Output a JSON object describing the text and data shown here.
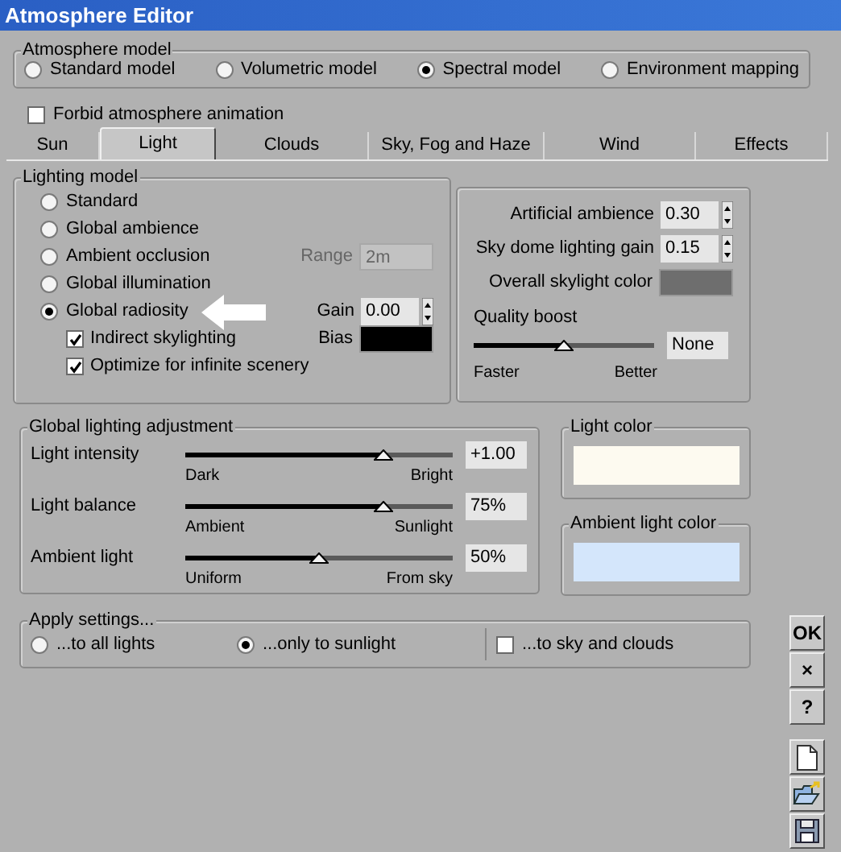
{
  "window": {
    "title": "Atmosphere Editor"
  },
  "atmosphere_model": {
    "label": "Atmosphere model",
    "options": [
      {
        "label": "Standard model",
        "selected": false
      },
      {
        "label": "Volumetric model",
        "selected": false
      },
      {
        "label": "Spectral model",
        "selected": true
      },
      {
        "label": "Environment mapping",
        "selected": false
      }
    ]
  },
  "forbid_animation": {
    "label": "Forbid atmosphere animation",
    "checked": false
  },
  "tabs": [
    {
      "label": "Sun",
      "selected": false
    },
    {
      "label": "Light",
      "selected": true
    },
    {
      "label": "Clouds",
      "selected": false
    },
    {
      "label": "Sky, Fog and Haze",
      "selected": false
    },
    {
      "label": "Wind",
      "selected": false
    },
    {
      "label": "Effects",
      "selected": false
    }
  ],
  "lighting_model": {
    "label": "Lighting model",
    "options": [
      {
        "label": "Standard",
        "selected": false
      },
      {
        "label": "Global ambience",
        "selected": false
      },
      {
        "label": "Ambient occlusion",
        "selected": false,
        "field": {
          "kind": "text",
          "label": "Range",
          "value": "2m",
          "disabled": true
        }
      },
      {
        "label": "Global illumination",
        "selected": false
      },
      {
        "label": "Global radiosity",
        "selected": true,
        "pointer": true,
        "field": {
          "kind": "spinner",
          "label": "Gain",
          "value": "0.00"
        }
      }
    ],
    "sub_options": [
      {
        "label": "Indirect skylighting",
        "checked": true,
        "field": {
          "kind": "swatch",
          "label": "Bias",
          "color": "#000000"
        }
      },
      {
        "label": "Optimize for infinite scenery",
        "checked": true
      }
    ]
  },
  "sky_settings": {
    "fields": [
      {
        "kind": "spinner",
        "label": "Artificial ambience",
        "value": "0.30"
      },
      {
        "kind": "spinner",
        "label": "Sky dome lighting gain",
        "value": "0.15"
      },
      {
        "kind": "swatch",
        "label": "Overall skylight color",
        "color": "#6e6e6e"
      }
    ],
    "quality_boost": {
      "label": "Quality boost",
      "level": 0.5,
      "value": "None",
      "min_label": "Faster",
      "max_label": "Better"
    }
  },
  "global_adjustment": {
    "label": "Global lighting adjustment",
    "sliders": [
      {
        "label": "Light intensity",
        "level": 0.74,
        "value": "+1.00",
        "min_label": "Dark",
        "max_label": "Bright"
      },
      {
        "label": "Light balance",
        "level": 0.74,
        "value": "75%",
        "min_label": "Ambient",
        "max_label": "Sunlight"
      },
      {
        "label": "Ambient light",
        "level": 0.5,
        "value": "50%",
        "min_label": "Uniform",
        "max_label": "From sky"
      }
    ]
  },
  "light_color": {
    "label": "Light color",
    "color": "#fdfaf0"
  },
  "ambient_light_color": {
    "label": "Ambient light color",
    "color": "#d4e6fb"
  },
  "apply_settings": {
    "label": "Apply settings...",
    "options": [
      {
        "kind": "radio",
        "label": "...to all lights",
        "selected": false
      },
      {
        "kind": "radio",
        "label": "...only to sunlight",
        "selected": true
      },
      {
        "kind": "checkbox",
        "label": "...to sky and clouds",
        "checked": false
      }
    ]
  },
  "side_buttons": [
    {
      "kind": "text",
      "label": "OK"
    },
    {
      "kind": "text",
      "label": "×"
    },
    {
      "kind": "text",
      "label": "?"
    },
    {
      "kind": "new"
    },
    {
      "kind": "open"
    },
    {
      "kind": "save"
    }
  ]
}
